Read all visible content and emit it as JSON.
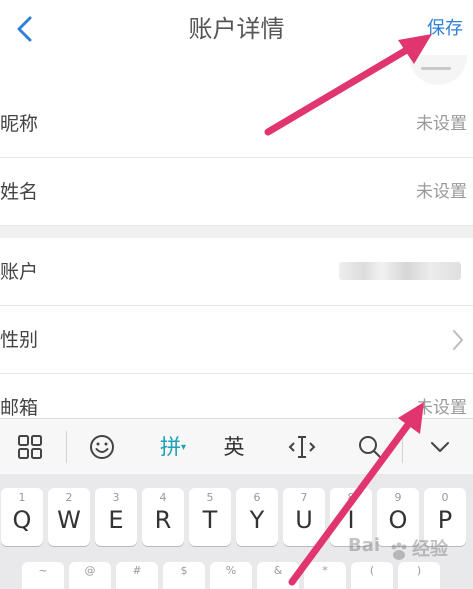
{
  "header": {
    "title": "账户详情",
    "save_label": "保存"
  },
  "rows": [
    {
      "label": "昵称",
      "value": "未设置"
    },
    {
      "label": "姓名",
      "value": "未设置"
    },
    {
      "label": "账户",
      "value": ""
    },
    {
      "label": "性别",
      "value": ""
    },
    {
      "label": "邮箱",
      "value": "未设置"
    }
  ],
  "keyboard": {
    "toolbar": {
      "pinyin_label": "拼",
      "english_label": "英"
    },
    "row1": [
      {
        "num": "1",
        "letter": "Q"
      },
      {
        "num": "2",
        "letter": "W"
      },
      {
        "num": "3",
        "letter": "E"
      },
      {
        "num": "4",
        "letter": "R"
      },
      {
        "num": "5",
        "letter": "T"
      },
      {
        "num": "6",
        "letter": "Y"
      },
      {
        "num": "7",
        "letter": "U"
      },
      {
        "num": "8",
        "letter": "I"
      },
      {
        "num": "9",
        "letter": "O"
      },
      {
        "num": "0",
        "letter": "P"
      }
    ],
    "row2": [
      {
        "sym": "~"
      },
      {
        "sym": "@"
      },
      {
        "sym": "#"
      },
      {
        "sym": "$"
      },
      {
        "sym": "%"
      },
      {
        "sym": "&"
      },
      {
        "sym": "*"
      },
      {
        "sym": "("
      },
      {
        "sym": ")"
      }
    ]
  },
  "watermark": {
    "text_left": "Bai",
    "text_right": "经验"
  },
  "colors": {
    "accent": "#2f80d8",
    "annotation_arrow": "#e0356f",
    "pinyin_active": "#1aa0b8"
  },
  "icons": {
    "back": "chevron-left-icon",
    "chevron": "chevron-right-icon",
    "grid": "grid-icon",
    "emoji": "emoji-icon",
    "cursor": "cursor-icon",
    "search": "search-icon",
    "collapse": "chevron-down-icon"
  }
}
